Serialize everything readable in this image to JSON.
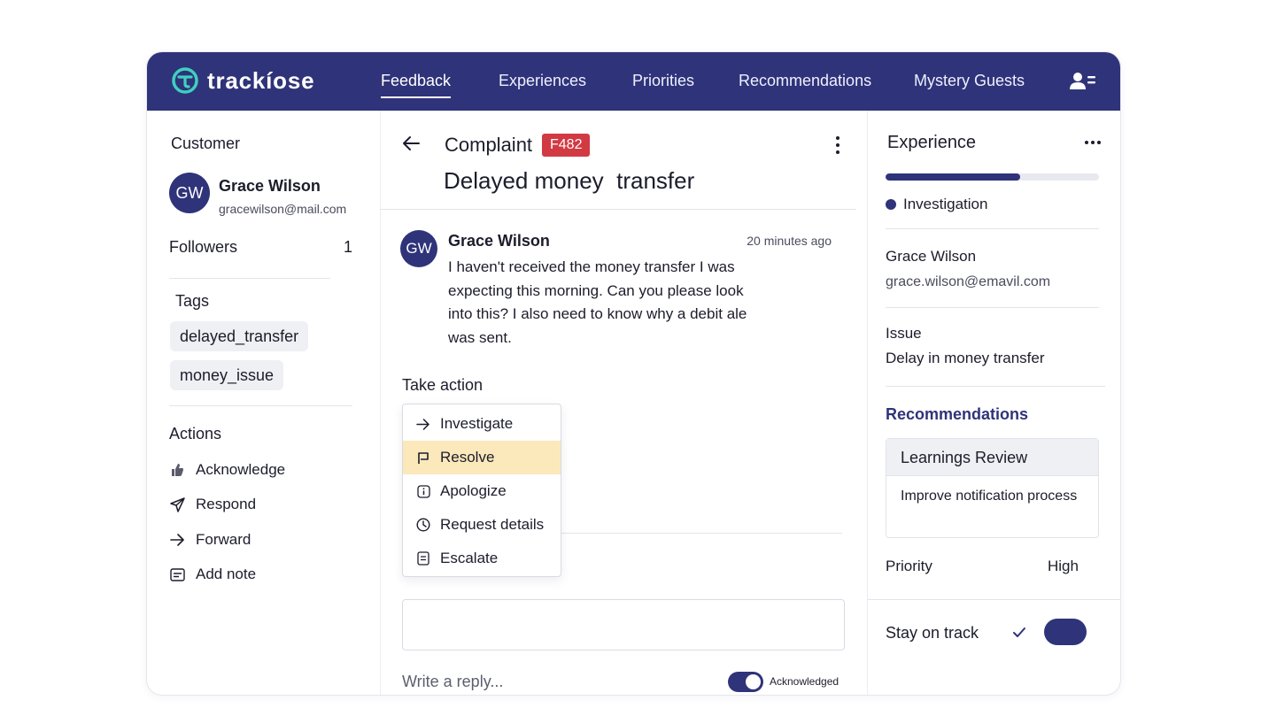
{
  "brand": {
    "name": "trackíose",
    "color": "#2f3379"
  },
  "nav": {
    "items": [
      {
        "label": "Feedback",
        "active": true
      },
      {
        "label": "Experiences"
      },
      {
        "label": "Priorities"
      },
      {
        "label": "Recommendations"
      },
      {
        "label": "Mystery Guests"
      }
    ],
    "user_icon": "user-list-icon"
  },
  "left": {
    "customer_label": "Customer",
    "customer": {
      "initials": "GW",
      "name": "Grace Wilson",
      "email": "gracewilson@mail.com"
    },
    "followers_label": "Followers",
    "followers_count": "1",
    "tags_label": "Tags",
    "tags": [
      "delayed_transfer",
      "money_issue"
    ],
    "actions_label": "Actions",
    "actions": [
      {
        "label": "Acknowledge",
        "icon": "thumbs-up-icon"
      },
      {
        "label": "Respond",
        "icon": "send-icon"
      },
      {
        "label": "Forward",
        "icon": "arrow-right-icon"
      },
      {
        "label": "Add note",
        "icon": "note-icon"
      }
    ]
  },
  "ticket": {
    "type": "Complaint",
    "id": "F482",
    "badge_color": "#d23a43",
    "title": "Delayed money  transfer",
    "message": {
      "initials": "GW",
      "author": "Grace Wilson",
      "time": "20 minutes ago",
      "body": "I haven't received the money transfer I was expecting this morning. Can you please look into this? I also need to know why a debit ale was sent."
    },
    "take_action_label": "Take action",
    "menu": [
      {
        "label": "Investigate",
        "icon": "arrow-right-icon"
      },
      {
        "label": "Resolve",
        "icon": "flag-icon",
        "highlighted": true
      },
      {
        "label": "Apologize",
        "icon": "info-icon"
      },
      {
        "label": "Request details",
        "icon": "clock-icon"
      },
      {
        "label": "Escalate",
        "icon": "document-icon"
      }
    ],
    "reply_placeholder": "Write a reply...",
    "toggle_label": "Acknowledged",
    "toggle_on": true
  },
  "right": {
    "experience_label": "Experience",
    "progress": 0.63,
    "stage": "Investigation",
    "contact": {
      "name": "Grace Wilson",
      "email": "grace.wilson@emavil.com"
    },
    "issue_label": "Issue",
    "issue_value": "Delay in money transfer",
    "recommendations_label": "Recommendations",
    "rec_card": {
      "title": "Learnings Review",
      "body": "Improve notification process"
    },
    "priority_label": "Priority",
    "priority_value": "High",
    "stay_label": "Stay on track"
  }
}
